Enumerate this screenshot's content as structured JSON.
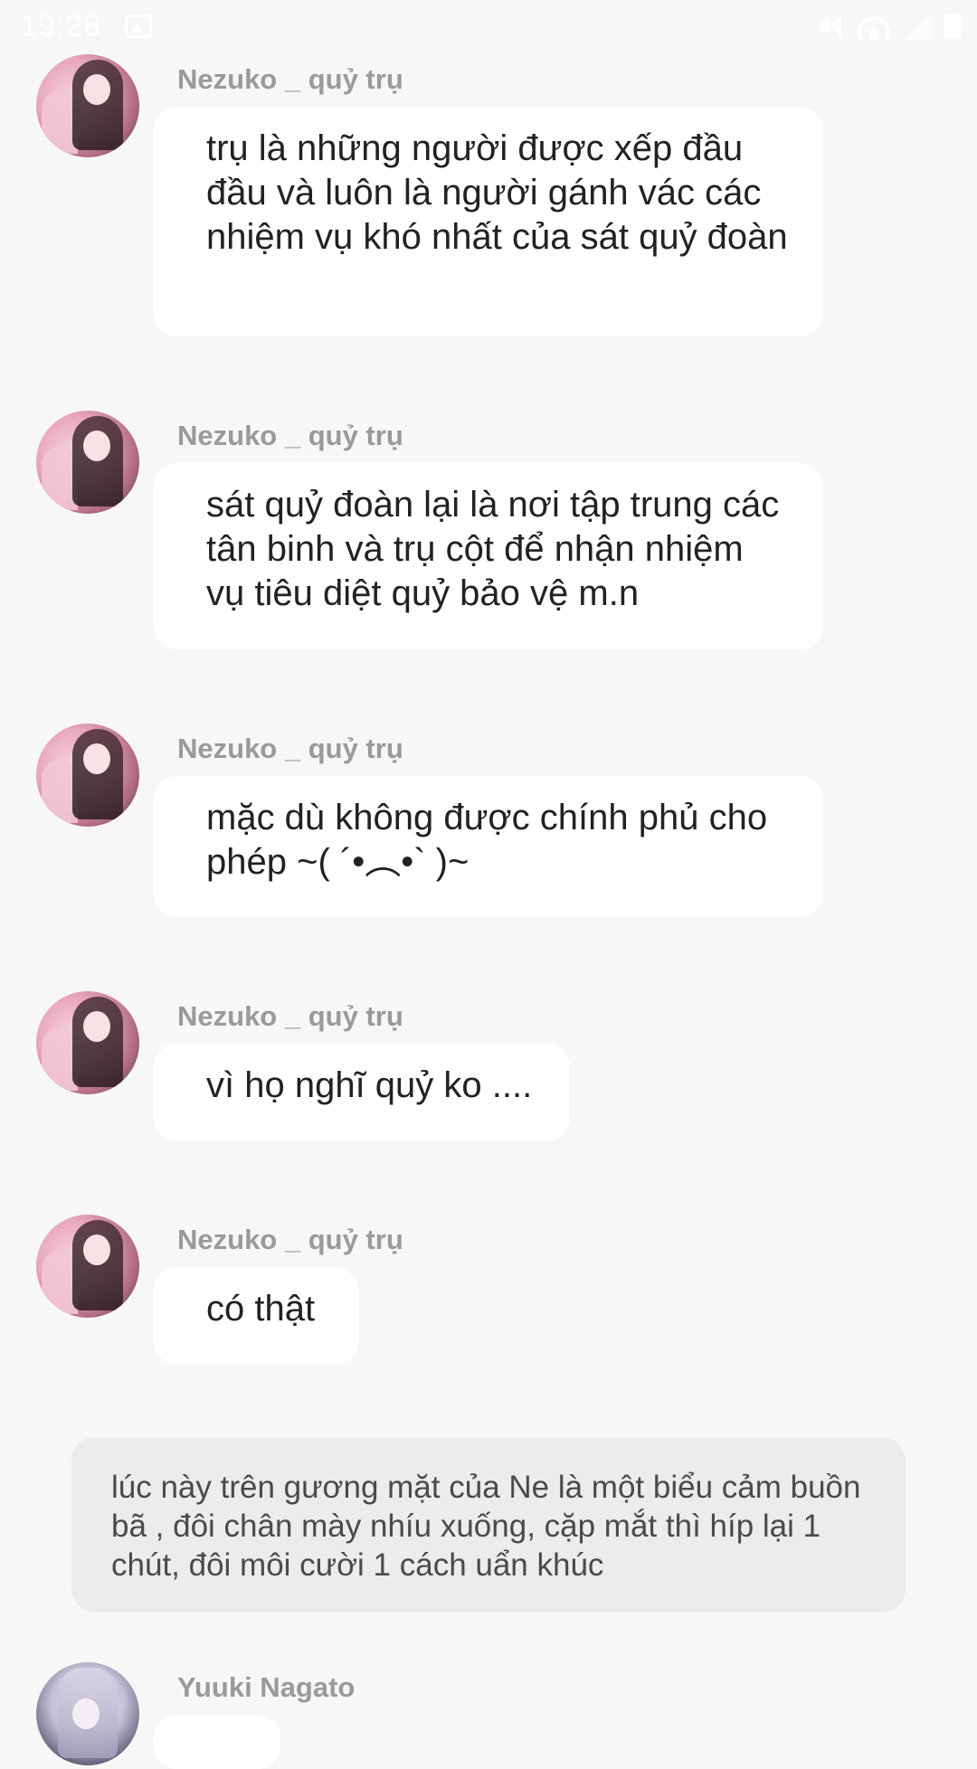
{
  "status_bar": {
    "time": "19:26",
    "icons": [
      "gallery-icon",
      "mute-icon",
      "wifi-icon",
      "signal-icon",
      "battery-icon"
    ]
  },
  "messages": [
    {
      "sender": "Nezuko _ quỷ trụ",
      "text": "trụ là những người được xếp đầu đầu và luôn là người gánh vác các nhiệm vụ khó nhất của sát quỷ đoàn"
    },
    {
      "sender": "Nezuko _ quỷ trụ",
      "text": "sát quỷ đoàn lại là nơi tập trung các tân binh và trụ cột để nhận nhiệm vụ tiêu diệt quỷ bảo vệ m.n"
    },
    {
      "sender": "Nezuko _ quỷ trụ",
      "text": "mặc dù không được chính phủ cho phép ~( ´•︵•` )~"
    },
    {
      "sender": "Nezuko _ quỷ trụ",
      "text": "vì họ nghĩ quỷ ko ...."
    },
    {
      "sender": "Nezuko _ quỷ trụ",
      "text": "có thật"
    }
  ],
  "narration": "lúc này trên gương mặt của Ne là một biểu cảm buồn bã , đôi chân mày nhíu xuống, cặp mắt thì híp lại 1 chút, đôi môi cười 1 cách uẩn khúc",
  "last_message": {
    "sender": "Yuuki Nagato"
  },
  "colors": {
    "background": "#f7f7f7",
    "bubble": "#ffffff",
    "narration_bg": "#ececec",
    "sender_text": "#9a9a9a",
    "message_text": "#222222"
  }
}
